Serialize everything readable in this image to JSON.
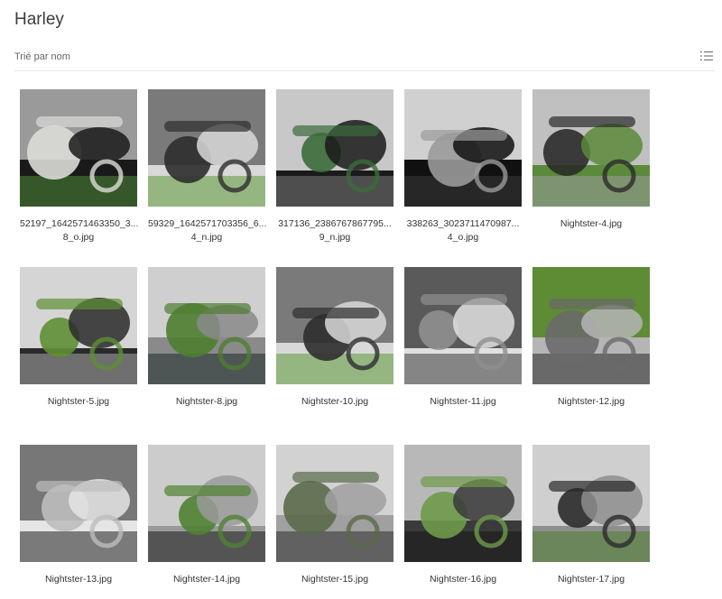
{
  "folder": {
    "title": "Harley",
    "sort_label": "Trié par nom"
  },
  "icons": {
    "view_toggle": "list-view-icon"
  },
  "files": [
    {
      "line1": "52197_1642571463350_3...",
      "line2": "8_o.jpg",
      "palette": [
        "#dcdcd8",
        "#4f8a36",
        "#1a1a1a",
        "#9a9a9a"
      ]
    },
    {
      "line1": "59329_1642571703356_6...",
      "line2": "4_n.jpg",
      "palette": [
        "#2e2e2e",
        "#5f9a3a",
        "#d8d8d8",
        "#7a7a7a"
      ]
    },
    {
      "line1": "317136_2386767867795...",
      "line2": "9_n.jpg",
      "palette": [
        "#3b6b3a",
        "#7a7a7a",
        "#1a1a1a",
        "#c8c8c8"
      ]
    },
    {
      "line1": "338263_3023711470987...",
      "line2": "4_o.jpg",
      "palette": [
        "#9a9a9a",
        "#3a3a3a",
        "#111111",
        "#d0d0d0"
      ]
    },
    {
      "line1": "Nightster-4.jpg",
      "line2": "",
      "palette": [
        "#2b2b2b",
        "#9c9c9c",
        "#5a8a3a",
        "#c0c0c0"
      ]
    },
    {
      "line1": "Nightster-5.jpg",
      "line2": "",
      "palette": [
        "#5e8f35",
        "#a8a8a8",
        "#2a2a2a",
        "#d5d5d5"
      ]
    },
    {
      "line1": "Nightster-8.jpg",
      "line2": "",
      "palette": [
        "#4e7d30",
        "#1d2a2a",
        "#8a8a8a",
        "#cfcfcf"
      ]
    },
    {
      "line1": "Nightster-10.jpg",
      "line2": "",
      "palette": [
        "#2e2e2e",
        "#5f9a3a",
        "#d8d8d8",
        "#7a7a7a"
      ]
    },
    {
      "line1": "Nightster-11.jpg",
      "line2": "",
      "palette": [
        "#8f8f8f",
        "#3a3a3a",
        "#e0e0e0",
        "#5a5a5a"
      ]
    },
    {
      "line1": "Nightster-12.jpg",
      "line2": "",
      "palette": [
        "#6a6a6a",
        "#2a2a2a",
        "#b5b5b5",
        "#5d8c35"
      ]
    },
    {
      "line1": "Nightster-13.jpg",
      "line2": "",
      "palette": [
        "#bdbdbd",
        "#232323",
        "#e5e5e5",
        "#777777"
      ]
    },
    {
      "line1": "Nightster-14.jpg",
      "line2": "",
      "palette": [
        "#4f8232",
        "#1c1c1c",
        "#9a9a9a",
        "#cccccc"
      ]
    },
    {
      "line1": "Nightster-15.jpg",
      "line2": "",
      "palette": [
        "#5a6a4a",
        "#2e2e2e",
        "#a0a0a0",
        "#d2d2d2"
      ]
    },
    {
      "line1": "Nightster-16.jpg",
      "line2": "",
      "palette": [
        "#6f9a4a",
        "#151515",
        "#3a3a3a",
        "#b8b8b8"
      ]
    },
    {
      "line1": "Nightster-17.jpg",
      "line2": "",
      "palette": [
        "#2a2a2a",
        "#4f7f30",
        "#8e8e8e",
        "#cfcfcf"
      ]
    }
  ]
}
